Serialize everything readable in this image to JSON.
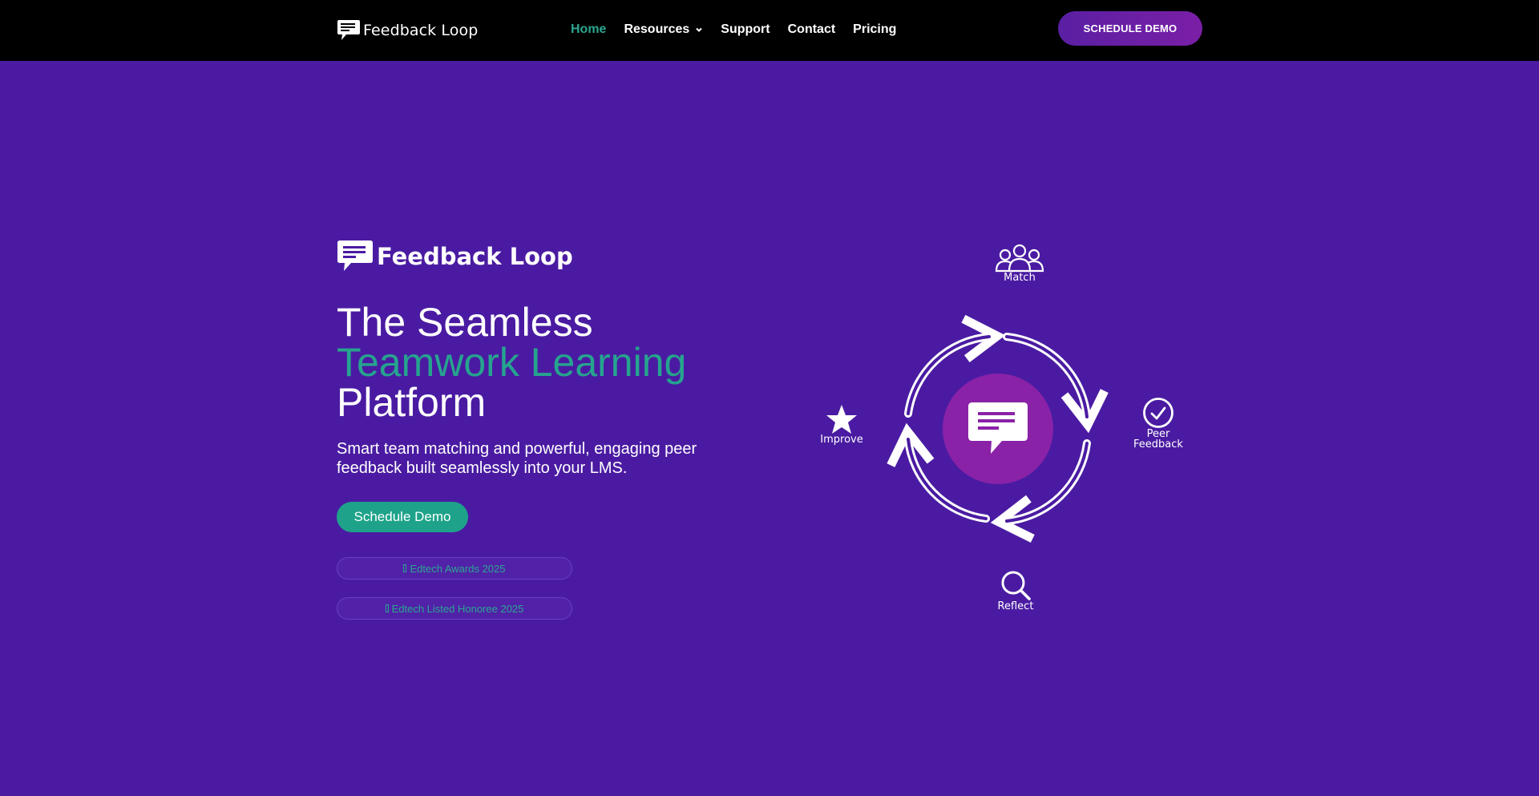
{
  "header": {
    "brand": "Feedback Loop",
    "nav": [
      {
        "label": "Home",
        "active": true
      },
      {
        "label": "Resources",
        "dropdown": true
      },
      {
        "label": "Support"
      },
      {
        "label": "Contact"
      },
      {
        "label": "Pricing"
      }
    ],
    "cta_label": "SCHEDULE DEMO"
  },
  "hero": {
    "brand": "Feedback Loop",
    "headline_line1": "The Seamless",
    "headline_accent": "Teamwork Learning",
    "headline_line3": "Platform",
    "subtitle": "Smart team matching and powerful, engaging peer feedback built seamlessly into your LMS.",
    "cta_label": "Schedule Demo",
    "awards": [
      {
        "label": "Edtech Awards 2025"
      },
      {
        "label": "Edtech Listed Honoree 2025"
      }
    ]
  },
  "diagram": {
    "match_label": "Match",
    "peer_feedback_label": "Peer\nFeedback",
    "improve_label": "Improve",
    "reflect_label": "Reflect",
    "icons": {
      "center": "chat-bubble-icon",
      "match": "people-group-icon",
      "peer_feedback": "check-circle-icon",
      "improve": "star-icon",
      "reflect": "magnifier-icon"
    }
  },
  "colors": {
    "background": "#4a1ba2",
    "header_bg": "#000000",
    "accent_teal": "#26a48e",
    "center_circle": "#8a22a8",
    "cta_gradient_start": "#5a1fa3",
    "cta_gradient_end": "#7a1fa6"
  }
}
